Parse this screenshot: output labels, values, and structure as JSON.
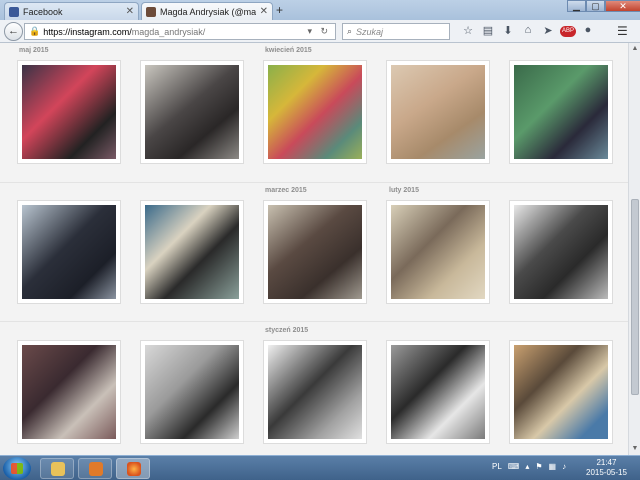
{
  "tabs": [
    {
      "title": "Facebook",
      "favicon_color": "#3b5998",
      "active": false
    },
    {
      "title": "Magda Andrysiak (@magd...",
      "favicon_color": "#6d4c3a",
      "active": true
    }
  ],
  "new_tab": "+",
  "nav": {
    "back": "←",
    "url_host": "https://instagram.com/",
    "url_path": "magda_andrysiak/",
    "search_placeholder": "Szukaj"
  },
  "months": [
    "maj 2015",
    "kwiecień 2015",
    "marzec 2015",
    "luty 2015",
    "styczeń 2015"
  ],
  "photos": [
    {
      "bg": "linear-gradient(135deg,#3a3346,#d3455a 40%,#222 75%,#7a5a66)"
    },
    {
      "bg": "linear-gradient(140deg,#c9c6bf,#4a4646 45%,#2a2727 70%,#8d8a86)"
    },
    {
      "bg": "linear-gradient(135deg,#8ab04a,#d6b73a 30%,#c94a5a 55%,#5a8a7a 80%,#9ab05a)"
    },
    {
      "bg": "linear-gradient(145deg,#dcc9b2,#c9a88a 40%,#a78a6a 70%,#9aa3a0)"
    },
    {
      "bg": "linear-gradient(135deg,#3a6a4a,#5a9a6a 40%,#2a2a3a 70%,#6a8a9a)"
    },
    {
      "bg": "linear-gradient(135deg,#b8c4cf,#2b2f3a 45%,#1c1f28 75%,#8a93a0)"
    },
    {
      "bg": "linear-gradient(135deg,#3a6a8a,#d9d2c0 35%,#2a2a2a 60%,#8aa09a)"
    },
    {
      "bg": "linear-gradient(140deg,#c8c0b0,#5a4a42 40%,#3a302c 70%,#a09a90)"
    },
    {
      "bg": "linear-gradient(135deg,#d8cfb8,#7a6a5a 40%,#c8b89a 70%,#e2d8c2)"
    },
    {
      "bg": "linear-gradient(135deg,#e8e8e8,#4a4a4a 40%,#2a2a2a 65%,#bbbbbb)"
    },
    {
      "bg": "linear-gradient(135deg,#6a4a4a,#3a2a30 40%,#c9c0b8 70%,#7a5a5a)"
    },
    {
      "bg": "linear-gradient(135deg,#d8d8d8,#9a9a9a 40%,#2a2a2a 70%,#cfcfcf)"
    },
    {
      "bg": "linear-gradient(135deg,#f0f0f0,#3a3a3a 45%,#a0a0a0 75%,#e0e0e0)"
    },
    {
      "bg": "linear-gradient(135deg,#9a9a9a,#2a2a2a 40%,#e6e6e6 70%,#7a7a7a)"
    },
    {
      "bg": "linear-gradient(135deg,#c9a070,#5a4a3a 35%,#d8c8a8 60%,#4a7aa8 85%)"
    }
  ],
  "taskbar": {
    "lang": "PL",
    "time": "21:47",
    "date": "2015-05-15"
  }
}
